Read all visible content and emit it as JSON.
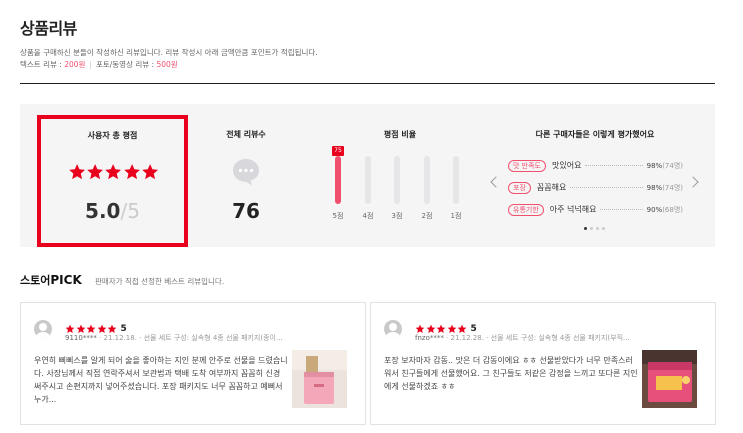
{
  "header": {
    "title": "상품리뷰",
    "desc": "상품을 구매하신 분들이 작성하신 리뷰입니다. 리뷰 작성시 아래 금액만큼 포인트가 적립됩니다.",
    "text_review_label": "텍스트 리뷰 : ",
    "text_review_point": "200원",
    "photo_review_label": "포토/동영상 리뷰 : ",
    "photo_review_point": "500원"
  },
  "summary": {
    "avg_title": "사용자 총 평점",
    "avg_score": "5.0",
    "avg_max": "/5",
    "avg_stars": 5,
    "total_title": "전체 리뷰수",
    "total_count": "76",
    "ratio_title": "평점 비율",
    "ratio_tag": "75",
    "ratio_bars": [
      {
        "label": "5점",
        "fraction": 1.0
      },
      {
        "label": "4점",
        "fraction": 0.0
      },
      {
        "label": "3점",
        "fraction": 0.0
      },
      {
        "label": "2점",
        "fraction": 0.0
      },
      {
        "label": "1점",
        "fraction": 0.0
      }
    ],
    "eval_title": "다른 구매자들은 이렇게 평가했어요",
    "evals": [
      {
        "tag": "맛 만족도",
        "text": "맛있어요",
        "pct": "98%",
        "count": "(74명)"
      },
      {
        "tag": "포장",
        "text": "꼼꼼해요",
        "pct": "98%",
        "count": "(74명)"
      },
      {
        "tag": "유통기한",
        "text": "아주 넉넉해요",
        "pct": "90%",
        "count": "(68명)"
      }
    ]
  },
  "pick": {
    "title_prefix": "스토어",
    "title_pick": "PICK",
    "subtitle": "판매자가 직접 선정한 베스트 리뷰입니다."
  },
  "reviews": [
    {
      "score": "5",
      "user": "9110****",
      "date": "21.12.18.",
      "option": "선물 세트 구성: 실속형 4종 선물 패키지(종이...",
      "body": "우연히 삐삐스를 알게 되어 술을 좋아하는 지인 분께 안주로 선물을 드렸습니다. 사장님께서 직접 연락주셔서 보관법과 택배 도착 여부까지 꼼꼼히 신경 써주시고 손편지까지 넣어주셨습니다. 포장 패키지도 너무 꼼꼼하고 예뻐서 누가..."
    },
    {
      "score": "5",
      "user": "fnzo****",
      "date": "21.12.28.",
      "option": "선물 세트 구성: 실속형 4종 선물 패키지(부직...",
      "body": "포장 보자마자 감동.. 맛은 더 감동이에요 ㅎㅎ 선물받았다가 너무 만족스러워서 친구들에게 선물했어요. 그 친구들도 저같은 감정을 느끼고 또다른 지인에게 선물하겠죠 ㅎㅎ"
    }
  ],
  "colors": {
    "accent": "#f0506e",
    "star": "#e8001c",
    "highlight_border": "#e8001c"
  }
}
